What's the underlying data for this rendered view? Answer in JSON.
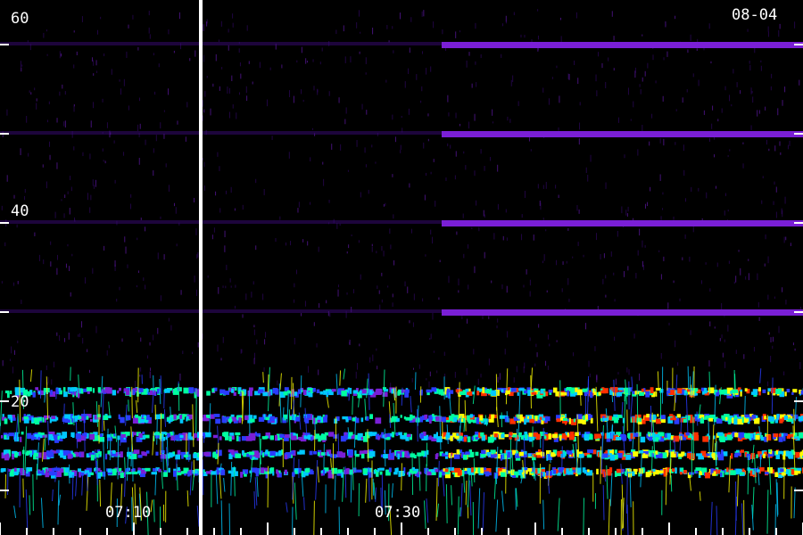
{
  "chart_data": {
    "type": "heatmap",
    "title": "",
    "date_label": "08-04",
    "xlabel": "",
    "ylabel": "",
    "y_tick_labels": [
      "60",
      "40",
      "20"
    ],
    "y_ticks": [
      60,
      50,
      40,
      30,
      20,
      10
    ],
    "ylim": [
      5,
      65
    ],
    "x_tick_labels": [
      "07:10",
      "07:30"
    ],
    "x_time_range": [
      "07:00",
      "07:60"
    ],
    "segment_boundaries_min": [
      14.9,
      33.0
    ],
    "strong_bands": [
      12,
      14,
      16,
      18,
      21
    ],
    "harmonic_lines": [
      30,
      40,
      50,
      60
    ],
    "colormap": [
      "#000000",
      "#3a0a78",
      "#7a1fd6",
      "#2a3cff",
      "#00c8ff",
      "#00ffa0",
      "#ffff00",
      "#ff3000"
    ],
    "grid": false,
    "legend": "none"
  }
}
